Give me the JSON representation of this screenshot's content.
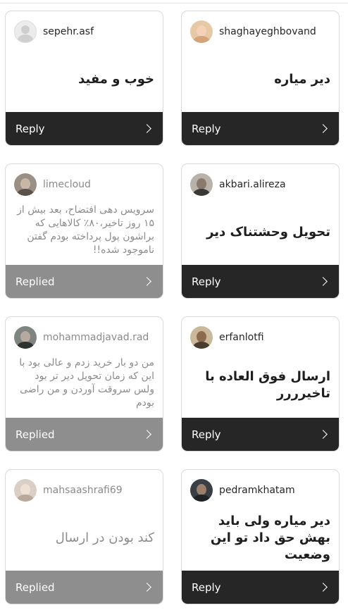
{
  "cards": [
    {
      "username": "sepehr.asf",
      "comment": "خوب و مفید",
      "action": "Reply",
      "avatar_icon": "default-profile-icon"
    },
    {
      "username": "shaghayeghbovand",
      "comment": "دیر میاره",
      "action": "Reply",
      "avatar_icon": "profile-photo"
    },
    {
      "username": "limecloud",
      "comment": "سرویس دهی افتضاح، بعد بیش از ۱۵ روز تاخیر،۸۰٪ کالاهایی که براشون پول پرداخته بودم گفتن ناموجود شده!!",
      "action": "Replied",
      "avatar_icon": "profile-photo"
    },
    {
      "username": "akbari.alireza",
      "comment": "تحویل وحشتناک دیر",
      "action": "Reply",
      "avatar_icon": "profile-photo"
    },
    {
      "username": "mohammadjavad.rad",
      "comment": "من دو بار خرید زدم و عالی بود با این که زمان تحویل دیر تر بود ولس سروقت آوردن و من راضی بودم",
      "action": "Replied",
      "avatar_icon": "profile-photo"
    },
    {
      "username": "erfanlotfi",
      "comment": "ارسال فوق العاده با تاخیرررر",
      "action": "Reply",
      "avatar_icon": "profile-photo"
    },
    {
      "username": "mahsaashrafi69",
      "comment": "کند بودن در ارسال",
      "action": "Replied",
      "avatar_icon": "profile-photo"
    },
    {
      "username": "pedramkhatam",
      "comment": "دیر میاره ولی باید بهش حق داد تو این وضعیت",
      "action": "Reply",
      "avatar_icon": "profile-photo"
    }
  ],
  "colors": {
    "reply_bar": "#262626",
    "replied_bar": "#8e8e8e"
  }
}
